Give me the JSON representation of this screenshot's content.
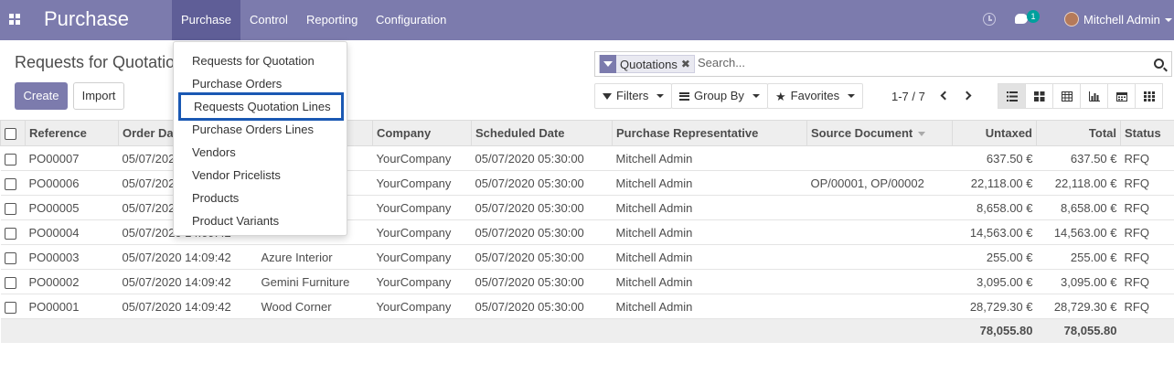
{
  "navbar": {
    "brand": "Purchase",
    "menu": [
      "Purchase",
      "Control",
      "Reporting",
      "Configuration"
    ],
    "active_menu": "Purchase",
    "chat_badge": "1",
    "user": "Mitchell Admin",
    "color": "#7c7bad"
  },
  "dropdown": {
    "items": [
      "Requests for Quotation",
      "Purchase Orders",
      "Requests Quotation Lines",
      "Purchase Orders Lines",
      "Vendors",
      "Vendor Pricelists",
      "Products",
      "Product Variants"
    ],
    "highlighted": "Requests Quotation Lines",
    "highlight_color": "#1a58b3"
  },
  "page": {
    "title": "Requests for Quotation",
    "create_label": "Create",
    "import_label": "Import"
  },
  "search": {
    "facet_label": "Quotations",
    "facet_remove": "✖",
    "placeholder": "Search..."
  },
  "filters": {
    "filters_label": "Filters",
    "groupby_label": "Group By",
    "favorites_label": "Favorites"
  },
  "pager": {
    "value": "1-7 / 7"
  },
  "views": [
    "list",
    "kanban",
    "pivot",
    "graph",
    "calendar",
    "activity"
  ],
  "table": {
    "columns": [
      "Reference",
      "Order Date",
      "Vendor",
      "Company",
      "Scheduled Date",
      "Purchase Representative",
      "Source Document",
      "Untaxed",
      "Total",
      "Status"
    ],
    "rows": [
      [
        "PO00007",
        "05/07/2020 14:09:42",
        "",
        "YourCompany",
        "05/07/2020 05:30:00",
        "Mitchell Admin",
        "",
        "637.50 €",
        "637.50 €",
        "RFQ"
      ],
      [
        "PO00006",
        "05/07/2020 14:09:42",
        "",
        "YourCompany",
        "05/07/2020 05:30:00",
        "Mitchell Admin",
        "OP/00001, OP/00002",
        "22,118.00 €",
        "22,118.00 €",
        "RFQ"
      ],
      [
        "PO00005",
        "05/07/2020 14:09:42",
        "",
        "YourCompany",
        "05/07/2020 05:30:00",
        "Mitchell Admin",
        "",
        "8,658.00 €",
        "8,658.00 €",
        "RFQ"
      ],
      [
        "PO00004",
        "05/07/2020 14:09:42",
        "",
        "YourCompany",
        "05/07/2020 05:30:00",
        "Mitchell Admin",
        "",
        "14,563.00 €",
        "14,563.00 €",
        "RFQ"
      ],
      [
        "PO00003",
        "05/07/2020 14:09:42",
        "Azure Interior",
        "YourCompany",
        "05/07/2020 05:30:00",
        "Mitchell Admin",
        "",
        "255.00 €",
        "255.00 €",
        "RFQ"
      ],
      [
        "PO00002",
        "05/07/2020 14:09:42",
        "Gemini Furniture",
        "YourCompany",
        "05/07/2020 05:30:00",
        "Mitchell Admin",
        "",
        "3,095.00 €",
        "3,095.00 €",
        "RFQ"
      ],
      [
        "PO00001",
        "05/07/2020 14:09:42",
        "Wood Corner",
        "YourCompany",
        "05/07/2020 05:30:00",
        "Mitchell Admin",
        "",
        "28,729.30 €",
        "28,729.30 €",
        "RFQ"
      ]
    ],
    "totals": {
      "untaxed": "78,055.80",
      "total": "78,055.80"
    }
  }
}
